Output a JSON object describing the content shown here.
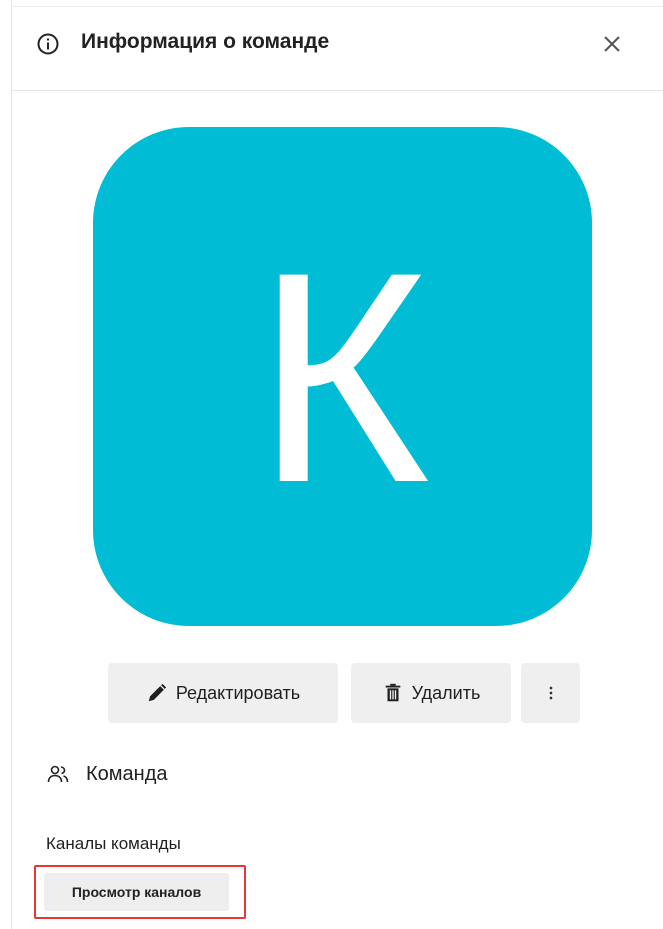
{
  "header": {
    "title": "Информация о команде",
    "info_icon": "info-icon",
    "close_icon": "close-icon"
  },
  "avatar": {
    "letter": "К",
    "color": "#00bcd4"
  },
  "actions": {
    "edit_label": "Редактировать",
    "edit_icon": "pencil-icon",
    "delete_label": "Удалить",
    "delete_icon": "trash-icon",
    "more_label": "⋮",
    "more_icon": "more-vertical-icon"
  },
  "team_section": {
    "title": "Команда",
    "icon": "people-icon"
  },
  "channels": {
    "label": "Каналы команды",
    "view_button_label": "Просмотр каналов"
  },
  "colors": {
    "highlight": "#e53935",
    "button_bg": "#efefef"
  }
}
